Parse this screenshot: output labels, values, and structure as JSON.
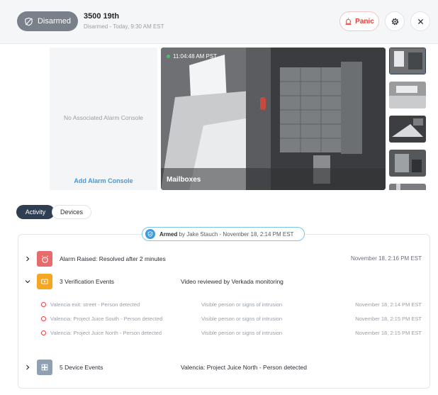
{
  "header": {
    "status_label": "Disarmed",
    "site_name": "3500 19th",
    "site_status": "Disarmed - Today, 9:30 AM EST",
    "panic_label": "Panic"
  },
  "console": {
    "empty_text": "No Associated Alarm Console",
    "add_label": "Add Alarm Console"
  },
  "camera": {
    "timestamp": "11:04:48 AM PST",
    "name": "Mailboxes"
  },
  "tabs": [
    {
      "label": "Activity",
      "active": true
    },
    {
      "label": "Devices",
      "active": false
    }
  ],
  "armed": {
    "state": "Armed",
    "detail": "by Jake Stauch - November 18, 2:14 PM EST"
  },
  "events": [
    {
      "title": "Alarm Raised: Resolved after 2 minutes",
      "desc": "",
      "time": "November 18, 2:16 PM EST",
      "icon": "alarm-icon",
      "color": "#e86b6b"
    },
    {
      "title": "3 Verification Events",
      "desc": "Video reviewed by Verkada monitoring",
      "time": "",
      "icon": "video-verification-icon",
      "color": "#f5a623"
    },
    {
      "title": "5 Device Events",
      "desc": "Valencia: Project Juice North - Person detected",
      "time": "",
      "icon": "device-grid-icon",
      "color": "#8fa0b3"
    }
  ],
  "verification_items": [
    {
      "title": "Valencia exit: street - Person detected",
      "desc": "Visible person or signs of intrusion",
      "time": "November 18, 2:14 PM EST"
    },
    {
      "title": "Valencia: Project Juice South - Person detected",
      "desc": "Visible person or signs of intrusion",
      "time": "November 18, 2:15 PM EST"
    },
    {
      "title": "Valencia: Project Juice North - Person detected",
      "desc": "Visible person or signs of intrusion",
      "time": "November 18, 2:15 PM EST"
    }
  ]
}
